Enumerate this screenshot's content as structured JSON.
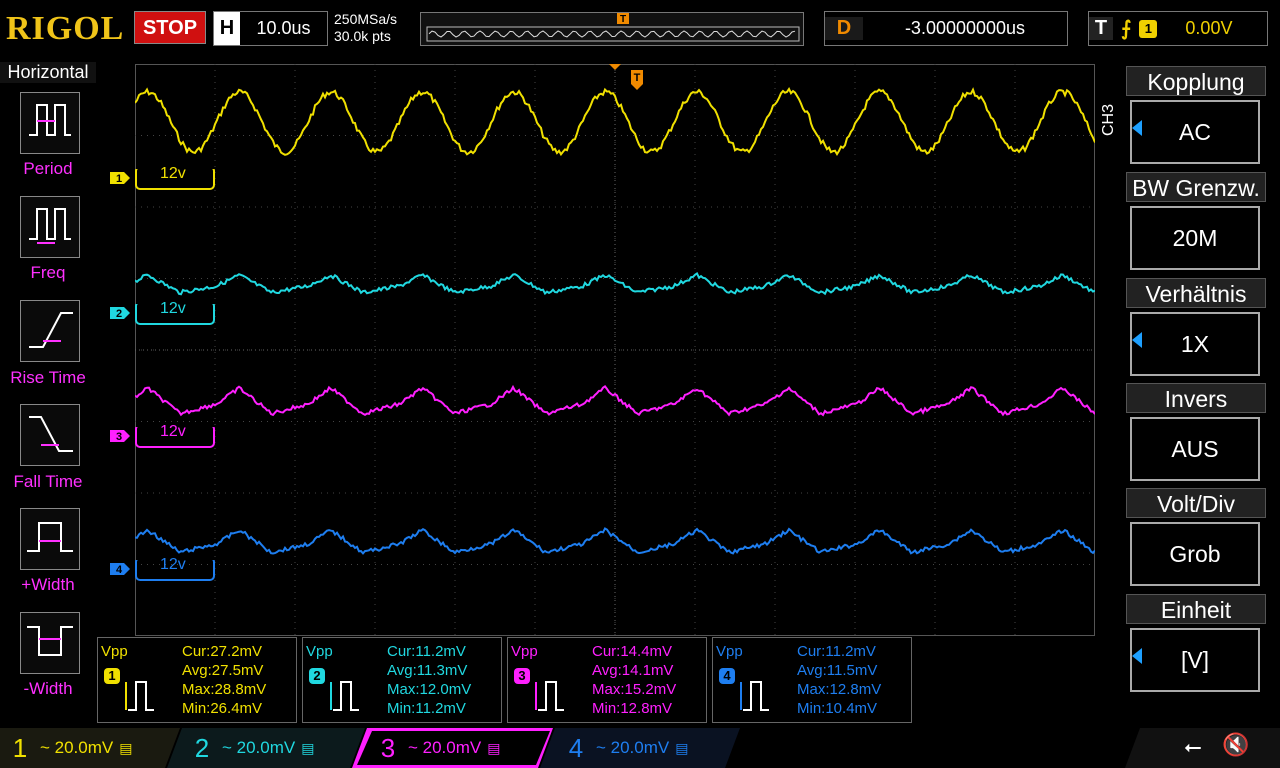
{
  "brand": "RIGOL",
  "run_state": "STOP",
  "timebase": {
    "label": "H",
    "value": "10.0us"
  },
  "sampling": {
    "rate": "250MSa/s",
    "points": "30.0k pts"
  },
  "delay": {
    "label": "D",
    "value": "-3.00000000us"
  },
  "trigger": {
    "label": "T",
    "edge": "⨍",
    "source": "1",
    "level": "0.00V"
  },
  "left_menu": {
    "title": "Horizontal",
    "items": [
      {
        "label": "Period",
        "icon": "period-icon"
      },
      {
        "label": "Freq",
        "icon": "frequency-icon"
      },
      {
        "label": "Rise Time",
        "icon": "rise-time-icon"
      },
      {
        "label": "Fall Time",
        "icon": "fall-time-icon"
      },
      {
        "label": "+Width",
        "icon": "positive-width-icon"
      },
      {
        "label": "-Width",
        "icon": "negative-width-icon"
      }
    ]
  },
  "channel_markers": [
    {
      "num": "1",
      "label": "12v",
      "color": "#f0e000"
    },
    {
      "num": "2",
      "label": "12v",
      "color": "#20d8e0"
    },
    {
      "num": "3",
      "label": "12v",
      "color": "#ff20ff"
    },
    {
      "num": "4",
      "label": "12v",
      "color": "#1e7ef0"
    }
  ],
  "right_menu": {
    "channel": "CH3",
    "items": [
      {
        "title": "Kopplung",
        "value": "AC",
        "arrow": true
      },
      {
        "title": "BW Grenzw.",
        "value": "20M",
        "arrow": false
      },
      {
        "title": "Verhältnis",
        "value": "1X",
        "arrow": true
      },
      {
        "title": "Invers",
        "value": "AUS",
        "arrow": false
      },
      {
        "title": "Volt/Div",
        "value": "Grob",
        "arrow": false
      },
      {
        "title": "Einheit",
        "value": "[V]",
        "arrow": true
      }
    ]
  },
  "measurements": [
    {
      "label": "Vpp",
      "num": "1",
      "color": "#f0e000",
      "cur": "Cur:27.2mV",
      "avg": "Avg:27.5mV",
      "max": "Max:28.8mV",
      "min": "Min:26.4mV"
    },
    {
      "label": "Vpp",
      "num": "2",
      "color": "#20d8e0",
      "cur": "Cur:11.2mV",
      "avg": "Avg:11.3mV",
      "max": "Max:12.0mV",
      "min": "Min:11.2mV"
    },
    {
      "label": "Vpp",
      "num": "3",
      "color": "#ff20ff",
      "cur": "Cur:14.4mV",
      "avg": "Avg:14.1mV",
      "max": "Max:15.2mV",
      "min": "Min:12.8mV"
    },
    {
      "label": "Vpp",
      "num": "4",
      "color": "#1e7ef0",
      "cur": "Cur:11.2mV",
      "avg": "Avg:11.5mV",
      "max": "Max:12.8mV",
      "min": "Min:10.4mV"
    }
  ],
  "channel_bar": [
    {
      "num": "1",
      "scale": "~ 20.0mV",
      "color": "#f0e000",
      "active": false
    },
    {
      "num": "2",
      "scale": "~ 20.0mV",
      "color": "#20d8e0",
      "active": false
    },
    {
      "num": "3",
      "scale": "~ 20.0mV",
      "color": "#ff20ff",
      "active": true
    },
    {
      "num": "4",
      "scale": "~ 20.0mV",
      "color": "#1e7ef0",
      "active": false
    }
  ],
  "status_icons": [
    "usb-icon",
    "speaker-muted-icon"
  ]
}
